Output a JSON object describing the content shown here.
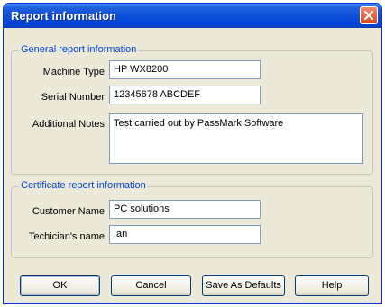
{
  "window": {
    "title": "Report information"
  },
  "general": {
    "title": "General report information",
    "machine_type_label": "Machine Type",
    "machine_type_value": "HP WX8200",
    "serial_number_label": "Serial Number",
    "serial_number_value": "12345678 ABCDEF",
    "notes_label": "Additional Notes",
    "notes_value": "Test carried out by PassMark Software"
  },
  "certificate": {
    "title": "Certificate report information",
    "customer_label": "Customer Name",
    "customer_value": "PC solutions",
    "technician_label": "Techician's name",
    "technician_value": "Ian"
  },
  "buttons": {
    "ok": "OK",
    "cancel": "Cancel",
    "save_defaults": "Save As Defaults",
    "help": "Help"
  },
  "colors": {
    "titlebar": "#0a4ed8",
    "group_title": "#0046d5",
    "dialog_bg": "#ece9d8",
    "close_button": "#d8481d"
  },
  "icons": {
    "close": "close-icon"
  }
}
